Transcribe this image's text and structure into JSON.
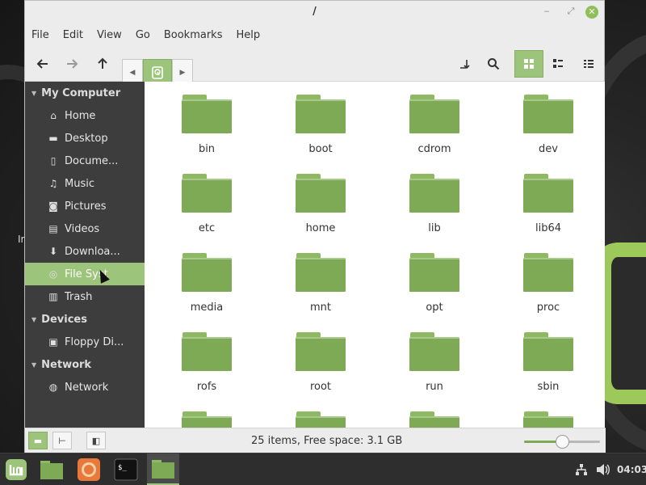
{
  "window": {
    "title": "/",
    "min_icon": "minimize-icon",
    "max_icon": "maximize-icon",
    "close_icon": "close-icon"
  },
  "desktop": {
    "text": "Ir"
  },
  "menu": [
    "File",
    "Edit",
    "View",
    "Go",
    "Bookmarks",
    "Help"
  ],
  "toolbar": {
    "back_icon": "arrow-left-icon",
    "forward_icon": "arrow-right-icon",
    "up_icon": "arrow-up-icon",
    "location_icon": "filesystem-icon",
    "terminal_icon": "open-terminal-icon",
    "search_icon": "search-icon",
    "view_icons": "icon-view-icon",
    "view_list": "list-view-icon",
    "view_compact": "compact-view-icon"
  },
  "sidebar": {
    "sections": [
      {
        "title": "My Computer",
        "items": [
          {
            "label": "Home",
            "icon": "home-icon"
          },
          {
            "label": "Desktop",
            "icon": "desktop-icon"
          },
          {
            "label": "Docume...",
            "icon": "document-icon"
          },
          {
            "label": "Music",
            "icon": "music-icon"
          },
          {
            "label": "Pictures",
            "icon": "camera-icon"
          },
          {
            "label": "Videos",
            "icon": "film-icon"
          },
          {
            "label": "Downloa...",
            "icon": "download-icon"
          },
          {
            "label": "File Syst",
            "icon": "filesystem-icon",
            "active": true
          },
          {
            "label": "Trash",
            "icon": "trash-icon"
          }
        ]
      },
      {
        "title": "Devices",
        "items": [
          {
            "label": "Floppy Di...",
            "icon": "floppy-icon"
          }
        ]
      },
      {
        "title": "Network",
        "items": [
          {
            "label": "Network",
            "icon": "network-icon"
          }
        ]
      }
    ]
  },
  "folders": [
    "bin",
    "boot",
    "cdrom",
    "dev",
    "etc",
    "home",
    "lib",
    "lib64",
    "media",
    "mnt",
    "opt",
    "proc",
    "rofs",
    "root",
    "run",
    "sbin",
    "",
    "",
    "",
    ""
  ],
  "status": {
    "text": "25 items, Free space: 3.1 GB",
    "zoom_fraction": 0.5
  },
  "taskbar": {
    "clock": "04:03"
  },
  "colors": {
    "accent": "#9cc47a",
    "folder": "#7faa55",
    "sidebar": "#3d3d3d"
  }
}
